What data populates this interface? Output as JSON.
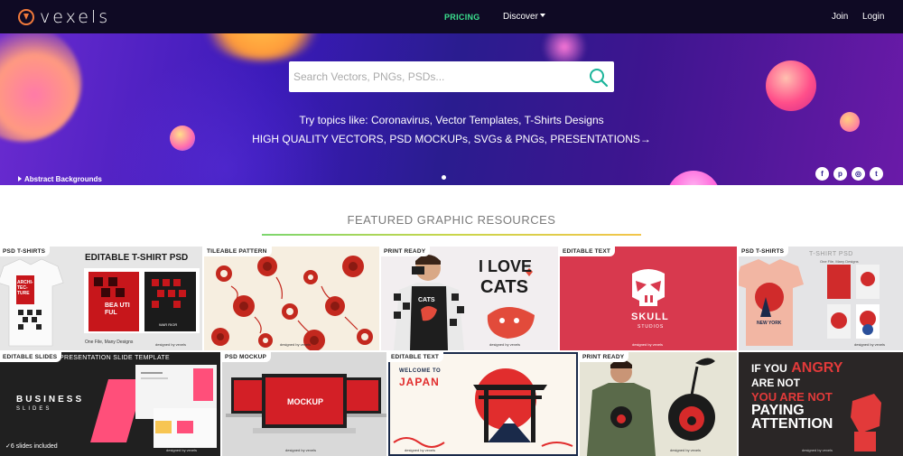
{
  "nav": {
    "logo": "vexels",
    "pricing": "PRICING",
    "discover": "Discover",
    "join": "Join",
    "login": "Login"
  },
  "hero": {
    "search_placeholder": "Search Vectors, PNGs, PSDs...",
    "topics": "Try topics like: Coronavirus, Vector Templates, T-Shirts Designs",
    "tagline": "HIGH QUALITY VECTORS, PSD MOCKUPs, SVGs & PNGs, PRESENTATIONS→",
    "caption": "Abstract Backgrounds",
    "social": [
      {
        "icon": "facebook-icon",
        "glyph": "f"
      },
      {
        "icon": "pinterest-icon",
        "glyph": "p"
      },
      {
        "icon": "instagram-icon",
        "glyph": "◎"
      },
      {
        "icon": "twitter-icon",
        "glyph": "t"
      }
    ]
  },
  "featured": {
    "title": "FEATURED GRAPHIC RESOURCES",
    "tiles": [
      {
        "tag": "PSD T-SHIRTS",
        "heading": "EDITABLE T-SHIRT PSD",
        "shirt_text": "ARCHI- TEC- TURE",
        "poster_text": "BEA UTI FUL",
        "poster2_text": "WAR RIOR",
        "footer": "One File, Many Designs",
        "brand": "designed by vexels"
      },
      {
        "tag": "TILEABLE PATTERN",
        "brand": "designed by vexels"
      },
      {
        "tag": "PRINT READY",
        "art_text_1": "I LOVE",
        "art_text_2": "CATS",
        "brand": "designed by vexels"
      },
      {
        "tag": "EDITABLE TEXT",
        "art_text": "SKULL",
        "art_sub": "STUDIOS",
        "brand": "designed by vexels"
      },
      {
        "tag": "PSD T-SHIRTS",
        "heading": "T-SHIRT PSD",
        "subheading": "One File, Many Designs",
        "shirt_text": "NEW YORK",
        "brand": "designed by vexels"
      },
      {
        "tag": "EDITABLE SLIDES",
        "heading": "PRESENTATION SLIDE TEMPLATE",
        "title_1": "BUSINESS",
        "title_2": "SLIDES",
        "footer": "6 slides included",
        "brand": "designed by vexels"
      },
      {
        "tag": "PSD MOCKUP",
        "screen_text": "MOCKUP",
        "brand": "designed by vexels"
      },
      {
        "tag": "EDITABLE TEXT",
        "art_text_1": "WELCOME TO",
        "art_text_2": "JAPAN",
        "brand": "designed by vexels"
      },
      {
        "tag": "PRINT READY",
        "brand": "designed by vexels"
      },
      {
        "art_lines": [
          "IF YOU",
          "ARE NOT",
          "ANGRY",
          "YOU ARE NOT",
          "PAYING",
          "ATTENTION"
        ],
        "brand": "designed by vexels"
      }
    ]
  },
  "colors": {
    "nav_bg": "#0f0a24",
    "pricing": "#3be08e",
    "search_icon": "#1ab49a",
    "hero_purple": "#3a1ab8"
  }
}
